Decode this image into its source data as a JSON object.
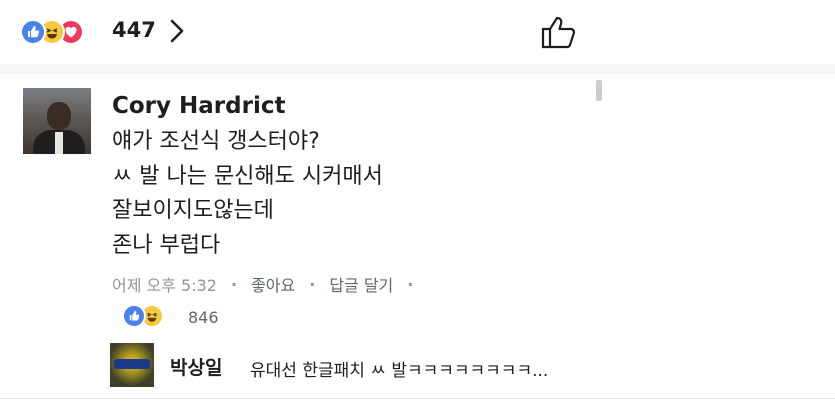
{
  "top": {
    "reaction_icons": [
      "like-icon",
      "haha-icon",
      "love-icon"
    ],
    "reaction_count": "447"
  },
  "comment": {
    "author": "Cory Hardrict",
    "lines": [
      "얘가 조선식 갱스터야?",
      "ㅆ 발 나는 문신해도 시커매서",
      "잘보이지도않는데",
      "존나 부럽다"
    ],
    "meta": {
      "time": "어제 오후 5:32",
      "like_label": "좋아요",
      "reply_label": "답글 달기",
      "separator": "·"
    },
    "reaction_icons": [
      "like-icon",
      "haha-icon"
    ],
    "reaction_count": "846"
  },
  "reply": {
    "author": "박상일",
    "text": "유대선 한글패치 ㅆ 발ㅋㅋㅋㅋㅋㅋㅋㅋ..."
  },
  "colors": {
    "like": "#4a80ef",
    "haha": "#f7c940",
    "love": "#f0395c",
    "text": "#1c1e21",
    "meta": "#90949c"
  }
}
